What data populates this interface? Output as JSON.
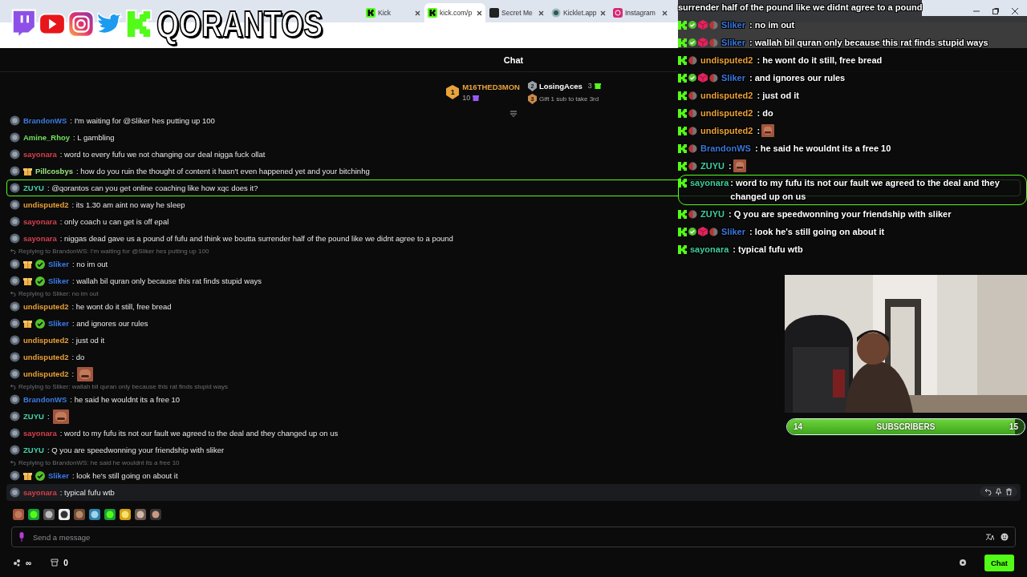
{
  "browser": {
    "tabs": [
      {
        "label": "Kick",
        "selected": false
      },
      {
        "label": "kick.com/p",
        "selected": true
      },
      {
        "label": "Secret Me",
        "selected": false
      },
      {
        "label": "Kicklet.app",
        "selected": false
      },
      {
        "label": "Instagram",
        "selected": false
      }
    ]
  },
  "stream_logo": {
    "title": "QORANTOS"
  },
  "chat": {
    "title": "Chat",
    "leaderboard": [
      {
        "rank": "1",
        "name": "M16THED3MON",
        "count": "10",
        "color": "#e8a33a"
      },
      {
        "rank": "2",
        "name": "LosingAces",
        "count": "3",
        "color": "#9aa0a6"
      },
      {
        "rank": "3",
        "name": "Gift 1 sub to take 3rd",
        "color": "#c98a4a"
      }
    ],
    "messages": [
      {
        "kind": "text",
        "user": "BrandonWS",
        "color": "#3d7be0",
        "text": ": I'm waiting for @Sliker hes putting up 100",
        "gift": false,
        "verified": false,
        "highlighted": false,
        "hovered": false
      },
      {
        "kind": "text",
        "user": "Amine_Rhoy",
        "color": "#72e05a",
        "text": ": L gambling",
        "gift": false,
        "verified": false,
        "highlighted": false,
        "hovered": false
      },
      {
        "kind": "text",
        "user": "sayonara",
        "color": "#d6404e",
        "text": ": word to every fufu we not changing our deal nigga fuck ollat",
        "gift": false,
        "verified": false,
        "highlighted": false,
        "hovered": false
      },
      {
        "kind": "text",
        "user": "Pillcosbys",
        "color": "#9ae67f",
        "text": ": how do you ruin the thought of content it hasn't even happened yet and your bitchinhg",
        "gift": true,
        "verified": false,
        "highlighted": false,
        "hovered": false
      },
      {
        "kind": "text",
        "user": "ZUYU",
        "color": "#43d3aa",
        "text": ": @qorantos can you get online coaching like how xqc does it?",
        "gift": false,
        "verified": false,
        "highlighted": true,
        "hovered": false
      },
      {
        "kind": "text",
        "user": "undisputed2",
        "color": "#e9a035",
        "text": ": its 1.30 am aint no way he sleep",
        "gift": false,
        "verified": false,
        "highlighted": false,
        "hovered": false
      },
      {
        "kind": "text",
        "user": "sayonara",
        "color": "#d6404e",
        "text": ": only coach u can get is off epal",
        "gift": false,
        "verified": false,
        "highlighted": false,
        "hovered": false
      },
      {
        "kind": "text",
        "user": "sayonara",
        "color": "#d6404e",
        "text": ": niggas dead gave us a pound of fufu and think we boutta surrender half of the pound like we didnt agree to a pound",
        "gift": false,
        "verified": false,
        "highlighted": false,
        "hovered": false
      },
      {
        "kind": "reply",
        "text": "Replying to BrandonWS: I'm waiting for @Sliker hes putting up 100"
      },
      {
        "kind": "text",
        "user": "Sliker",
        "color": "#3b7be8",
        "text": ": no im out",
        "gift": true,
        "verified": true,
        "highlighted": false,
        "hovered": false
      },
      {
        "kind": "text",
        "user": "Sliker",
        "color": "#3b7be8",
        "text": ": wallah bil quran only because this rat finds stupid ways",
        "gift": true,
        "verified": true,
        "highlighted": false,
        "hovered": false
      },
      {
        "kind": "reply",
        "text": "Replying to Sliker: no im out"
      },
      {
        "kind": "text",
        "user": "undisputed2",
        "color": "#e9a035",
        "text": ": he wont do it still, free bread",
        "gift": false,
        "verified": false,
        "highlighted": false,
        "hovered": false
      },
      {
        "kind": "text",
        "user": "Sliker",
        "color": "#3b7be8",
        "text": ": and ignores our rules",
        "gift": true,
        "verified": true,
        "highlighted": false,
        "hovered": false
      },
      {
        "kind": "text",
        "user": "undisputed2",
        "color": "#e9a035",
        "text": ": just od it",
        "gift": false,
        "verified": false,
        "highlighted": false,
        "hovered": false
      },
      {
        "kind": "text",
        "user": "undisputed2",
        "color": "#e9a035",
        "text": ": do",
        "gift": false,
        "verified": false,
        "highlighted": false,
        "hovered": false
      },
      {
        "kind": "emote",
        "user": "undisputed2",
        "color": "#e9a035",
        "text": ":",
        "gift": false,
        "verified": false,
        "highlighted": false,
        "hovered": false
      },
      {
        "kind": "reply",
        "text": "Replying to Sliker: wallah bil quran only because this rat finds stupid ways"
      },
      {
        "kind": "text",
        "user": "BrandonWS",
        "color": "#3d7be0",
        "text": ": he said he wouldnt its a free 10",
        "gift": false,
        "verified": false,
        "highlighted": false,
        "hovered": false
      },
      {
        "kind": "emote",
        "user": "ZUYU",
        "color": "#43d3aa",
        "text": ":",
        "gift": false,
        "verified": false,
        "highlighted": false,
        "hovered": false
      },
      {
        "kind": "text",
        "user": "sayonara",
        "color": "#d6404e",
        "text": ": word to my fufu its not our fault we agreed to the deal and they changed up on us",
        "gift": false,
        "verified": false,
        "highlighted": false,
        "hovered": false
      },
      {
        "kind": "text",
        "user": "ZUYU",
        "color": "#43d3aa",
        "text": ": Q you are speedwonning your friendship with sliker",
        "gift": false,
        "verified": false,
        "highlighted": false,
        "hovered": false
      },
      {
        "kind": "reply",
        "text": "Replying to BrandonWS: he said he wouldnt its a free 10"
      },
      {
        "kind": "text",
        "user": "Sliker",
        "color": "#3b7be8",
        "text": ": look he's still going on about it",
        "gift": true,
        "verified": true,
        "highlighted": false,
        "hovered": false
      },
      {
        "kind": "text",
        "user": "sayonara",
        "color": "#d6404e",
        "text": ": typical fufu wtb",
        "gift": false,
        "verified": false,
        "highlighted": false,
        "hovered": true
      }
    ],
    "input": {
      "placeholder": "Send a message"
    },
    "footer": {
      "points": "∞",
      "store_count": "0",
      "send_label": "Chat"
    }
  },
  "overlay_chat": {
    "messages": [
      {
        "kind": "continuation",
        "text": "surrender half of the pound like we didnt agree to a pound"
      },
      {
        "kind": "text",
        "user": "Sliker",
        "color": "#3b78e0",
        "text": " : no im out",
        "verified": true,
        "sub": true,
        "avatar": true
      },
      {
        "kind": "text",
        "user": "Sliker",
        "color": "#3b78e0",
        "text": " : wallah bil quran only because this rat finds stupid ways",
        "verified": true,
        "sub": true,
        "avatar": true
      },
      {
        "kind": "text",
        "user": "undisputed2",
        "color": "#e9a035",
        "text": " : he wont do it still, free bread",
        "verified": false,
        "sub": false,
        "avatar": true
      },
      {
        "kind": "text",
        "user": "Sliker",
        "color": "#3b78e0",
        "text": " : and ignores our rules",
        "verified": true,
        "sub": true,
        "avatar": true
      },
      {
        "kind": "text",
        "user": "undisputed2",
        "color": "#e9a035",
        "text": " : just od it",
        "verified": false,
        "sub": false,
        "avatar": true
      },
      {
        "kind": "text",
        "user": "undisputed2",
        "color": "#e9a035",
        "text": " : do",
        "verified": false,
        "sub": false,
        "avatar": true
      },
      {
        "kind": "emote",
        "user": "undisputed2",
        "color": "#e9a035",
        "text": " :",
        "verified": false,
        "sub": false,
        "avatar": true
      },
      {
        "kind": "text",
        "user": "BrandonWS",
        "color": "#3d75d6",
        "text": " : he said he wouldnt its a free 10",
        "verified": false,
        "sub": false,
        "avatar": true
      },
      {
        "kind": "emote",
        "user": "ZUYU",
        "color": "#3fcf9e",
        "text": " :",
        "verified": false,
        "sub": false,
        "avatar": true
      },
      {
        "kind": "highlight",
        "user": "sayonara",
        "color": "#3fcf9e",
        "text": " : word to my fufu its not our fault we agreed to the deal and they changed up on us",
        "verified": false,
        "sub": false,
        "avatar": false
      },
      {
        "kind": "text",
        "user": "ZUYU",
        "color": "#3fcf9e",
        "text": " : Q you are speedwonning your friendship with sliker",
        "verified": false,
        "sub": false,
        "avatar": true
      },
      {
        "kind": "text",
        "user": "Sliker",
        "color": "#3b78e0",
        "text": " : look he's still going on about it",
        "verified": true,
        "sub": true,
        "avatar": true
      },
      {
        "kind": "text",
        "user": "sayonara",
        "color": "#3fcf9e",
        "text": " : typical fufu wtb",
        "verified": false,
        "sub": false,
        "avatar": false
      }
    ]
  },
  "sub_goal": {
    "start": "14",
    "label": "SUBSCRIBERS",
    "end": "15",
    "level": 0.96
  }
}
